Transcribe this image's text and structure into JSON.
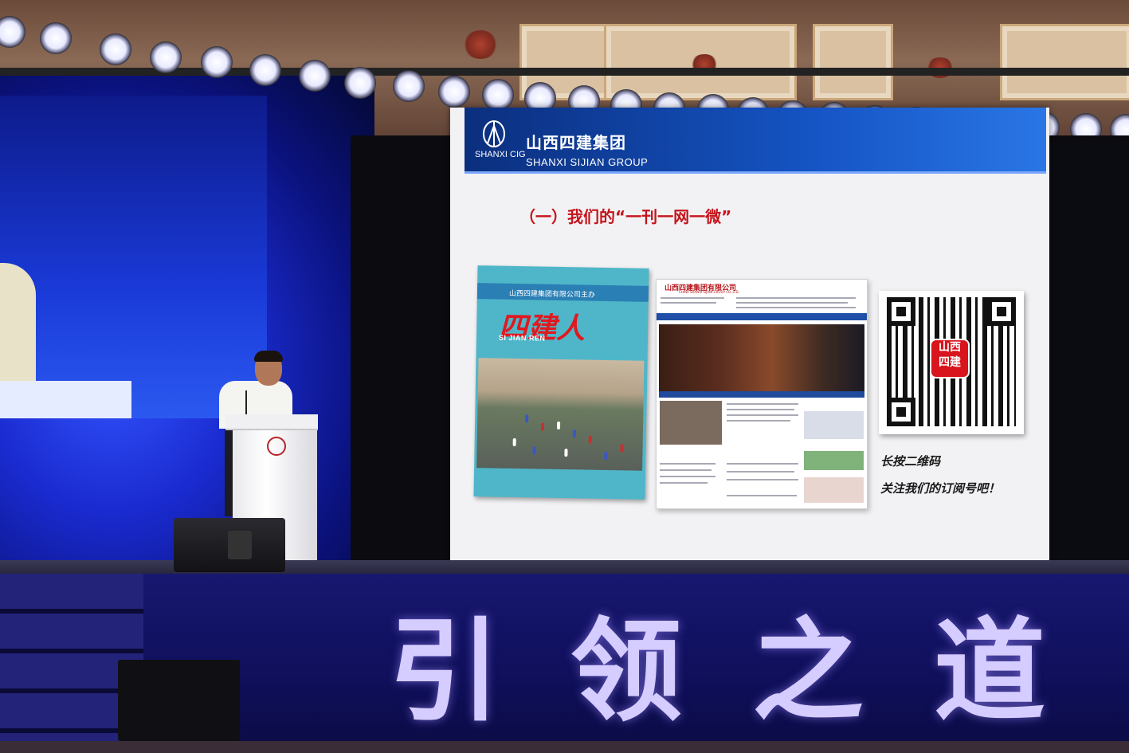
{
  "slide": {
    "brand_cn": "山西四建集团",
    "brand_en": "SHANXI SIJIAN GROUP",
    "brand_abbr": "SHANXI CIG",
    "heading": "（一）我们的“一刊一网一微”"
  },
  "magazine": {
    "band_text": "山西四建集团有限公司主办",
    "title": "四建人",
    "subtitle": "SI JIAN REN"
  },
  "website": {
    "logo_cn": "山西四建集团有限公司",
    "logo_en": "CHINA SHANXI SIJIAN GROUP CO.,LTD."
  },
  "qr": {
    "badge_text": "山西四建",
    "line1": "长按二维码",
    "line2": "关注我们的订阅号吧！"
  },
  "stage": {
    "slogan": "引领之道"
  },
  "colors": {
    "slide_header": "#1554c4",
    "heading_red": "#c6131b",
    "led_blue": "#1a2bd0",
    "slogan": "#d5ccff"
  }
}
